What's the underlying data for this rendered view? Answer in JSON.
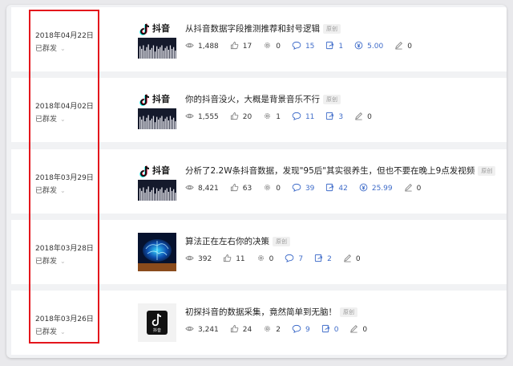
{
  "status_label": "已群发",
  "tag_label": "原创",
  "colors": {
    "highlight_box": "#e4161c",
    "link_blue": "#3f6cc9",
    "background": "#e9e9ec"
  },
  "articles": [
    {
      "date": "2018年04月22日",
      "title": "从抖音数据字段推测推荐和封号逻辑",
      "thumb": "douyin-logo-bars",
      "views": "1,488",
      "likes": "17",
      "shares": "0",
      "comments": "15",
      "forwards": "1",
      "reward": "5.00",
      "edits": "0"
    },
    {
      "date": "2018年04月02日",
      "title": "你的抖音没火，大概是背景音乐不行",
      "thumb": "douyin-logo-bars",
      "views": "1,555",
      "likes": "20",
      "shares": "1",
      "comments": "11",
      "forwards": "3",
      "reward": null,
      "edits": "0"
    },
    {
      "date": "2018年03月29日",
      "title": "分析了2.2W条抖音数据，发现\"95后\"其实很养生，但也不要在晚上9点发视频",
      "thumb": "douyin-logo-bars",
      "views": "8,421",
      "likes": "63",
      "shares": "0",
      "comments": "39",
      "forwards": "42",
      "reward": "25.99",
      "edits": "0"
    },
    {
      "date": "2018年03月28日",
      "title": "算法正在左右你的决策",
      "thumb": "glowing-brain",
      "views": "392",
      "likes": "11",
      "shares": "0",
      "comments": "7",
      "forwards": "2",
      "reward": null,
      "edits": "0"
    },
    {
      "date": "2018年03月26日",
      "title": "初探抖音的数据采集，竟然简单到无脑！",
      "thumb": "douyin-app-icon",
      "views": "3,241",
      "likes": "24",
      "shares": "2",
      "comments": "9",
      "forwards": "0",
      "reward": null,
      "edits": "0"
    }
  ],
  "thumb_text": {
    "douyin": "抖音"
  }
}
